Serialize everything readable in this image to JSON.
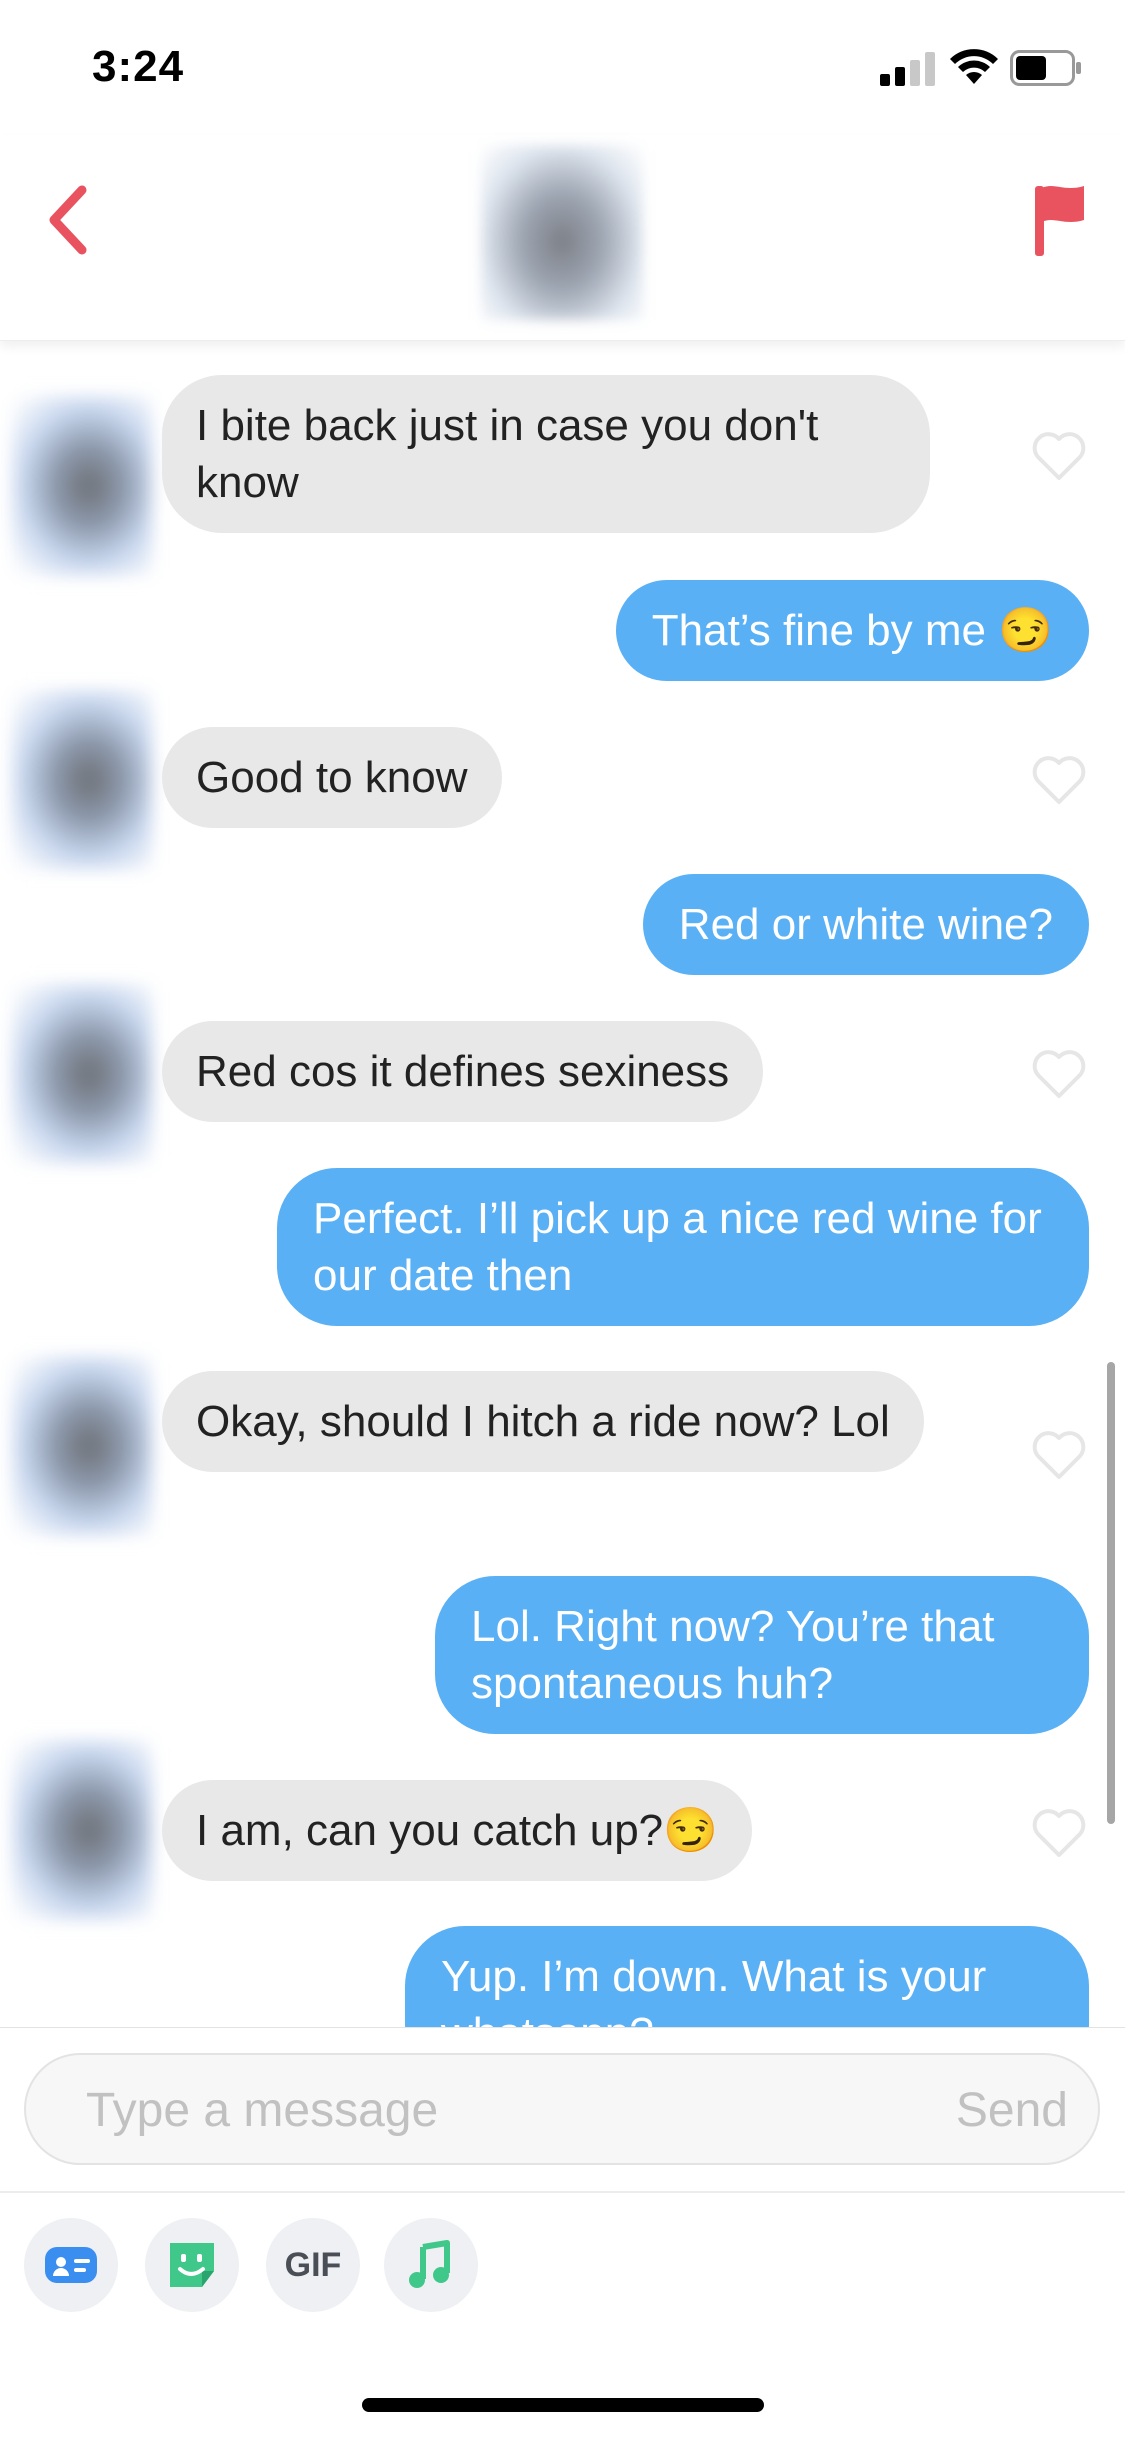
{
  "status": {
    "time": "3:24",
    "signal_icon": "cellular-signal-icon",
    "wifi_icon": "wifi-icon",
    "battery_icon": "battery-icon"
  },
  "header": {
    "back_icon": "chevron-left-icon",
    "avatar": "profile-photo-blurred",
    "flag_icon": "flag-icon",
    "accent_color": "#e8535f"
  },
  "messages": [
    {
      "side": "received",
      "text": "I bite back just in case you don't know"
    },
    {
      "side": "sent",
      "text": "That’s fine by me 😏"
    },
    {
      "side": "received",
      "text": "Good to know"
    },
    {
      "side": "sent",
      "text": "Red or white wine?"
    },
    {
      "side": "received",
      "text": "Red cos it defines sexiness"
    },
    {
      "side": "sent",
      "text": "Perfect. I’ll pick up a nice red wine for our date then"
    },
    {
      "side": "received",
      "text": "Okay, should I hitch a ride now? Lol"
    },
    {
      "side": "sent",
      "text": "Lol. Right now? You’re that spontaneous huh?"
    },
    {
      "side": "received",
      "text": "I am, can you catch up?😏"
    },
    {
      "side": "sent",
      "text": "Yup. I’m down. What is your whatsapp?"
    }
  ],
  "composer": {
    "placeholder": "Type a message",
    "send_label": "Send"
  },
  "toolbar": {
    "gif_label": "GIF",
    "icons": [
      "contact-card-icon",
      "sticker-icon",
      "gif-icon",
      "music-note-icon"
    ]
  },
  "colors": {
    "sent_bubble": "#5ab0f5",
    "received_bubble": "#e8e8e8",
    "accent": "#e8535f"
  }
}
